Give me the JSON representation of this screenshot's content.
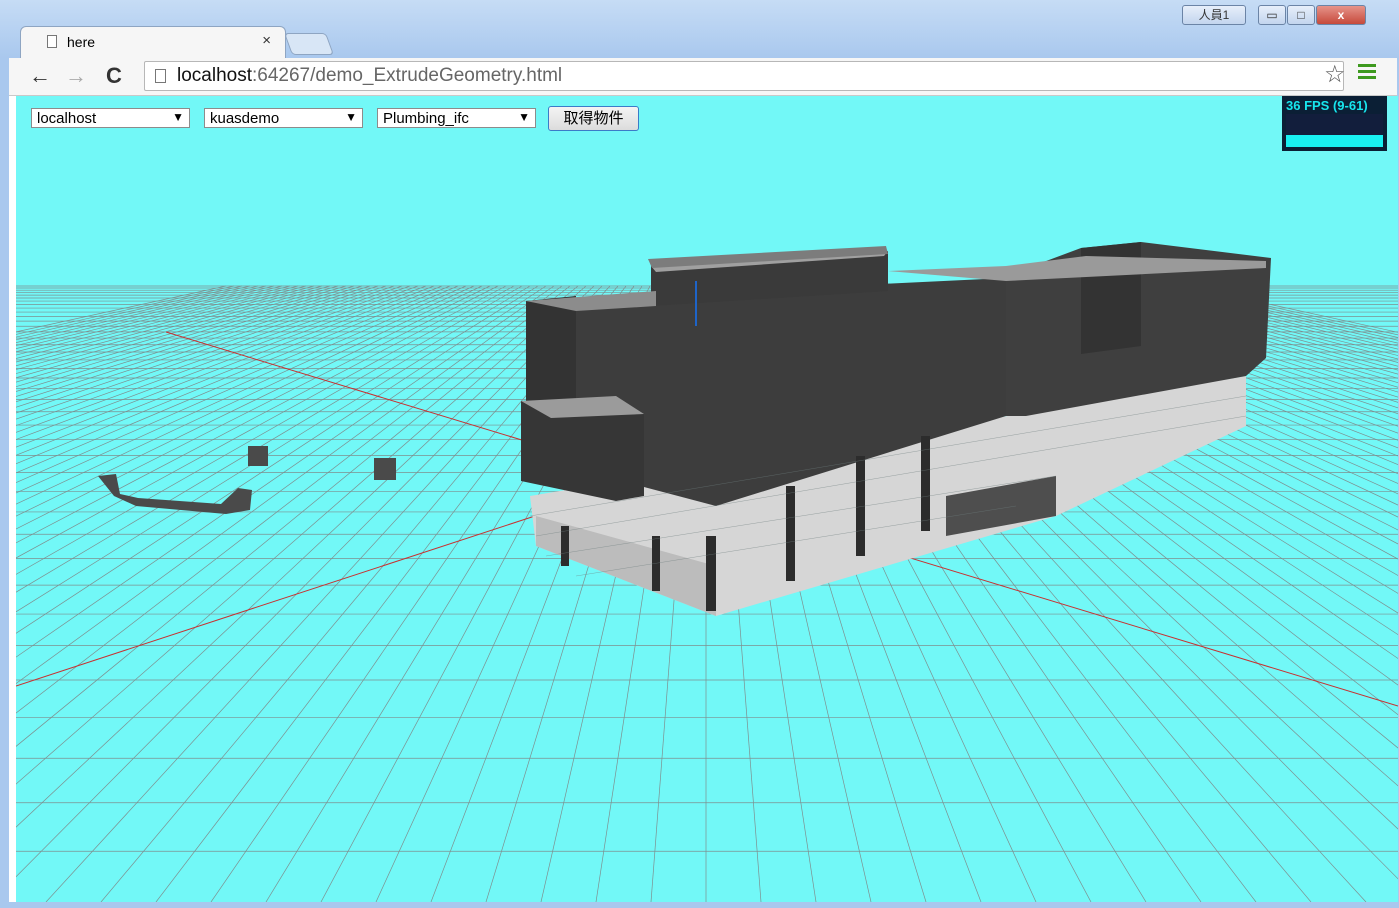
{
  "window": {
    "user_badge": "人員1",
    "minimize": "▭",
    "maximize": "□",
    "close": "x"
  },
  "tab": {
    "title": "here",
    "close": "×"
  },
  "toolbar": {
    "back": "←",
    "forward": "→",
    "reload": "C",
    "url_host": "localhost",
    "url_path": ":64267/demo_ExtrudeGeometry.html",
    "star": "☆"
  },
  "controls": {
    "server": "localhost",
    "database": "kuasdemo",
    "model": "Plumbing_ifc",
    "dropdown_arrow": "▼",
    "get_button": "取得物件"
  },
  "fps": {
    "label": "36 FPS (9-61)"
  },
  "colors": {
    "background": "#72f8f7",
    "grid": "#7a8c8c",
    "axis": "#cc2222",
    "building": "#3f3f3f"
  }
}
